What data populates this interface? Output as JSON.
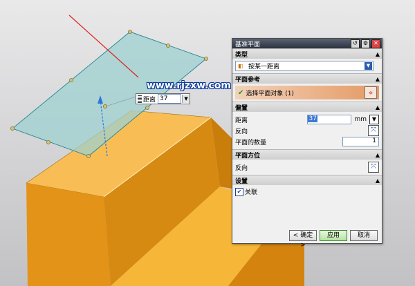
{
  "watermark": "www.rjzxw.com",
  "distance_input": {
    "label": "距离",
    "value": "37"
  },
  "dialog": {
    "title": "基准平面",
    "sections": {
      "type": {
        "title": "类型",
        "selected": "按某一距离"
      },
      "plane_ref": {
        "title": "平面参考",
        "select_text": "选择平面对象 (1)"
      },
      "offset": {
        "title": "偏置",
        "distance_label": "距离",
        "distance_value": "37",
        "unit": "mm",
        "reverse_label": "反向",
        "count_label": "平面的数量",
        "count_value": "1"
      },
      "orientation": {
        "title": "平面方位",
        "reverse_label": "反向"
      },
      "settings": {
        "title": "设置",
        "associative_label": "关联",
        "associative_checked": true
      }
    },
    "buttons": {
      "ok": "< 确定 >",
      "apply": "应用",
      "cancel": "取消"
    }
  },
  "colors": {
    "solid": "#f5a623",
    "plane": "#9fd0d0",
    "accent": "#2a5db0"
  }
}
